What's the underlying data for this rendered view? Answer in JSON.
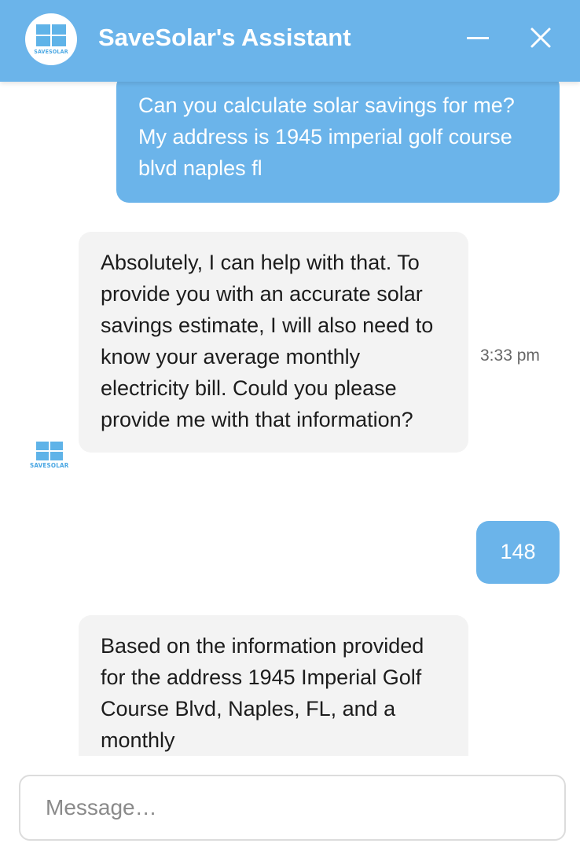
{
  "header": {
    "title": "SaveSolar's Assistant",
    "logo_text": "SAVESOLAR",
    "minimize_icon": "minimize-icon",
    "close_icon": "close-icon",
    "accent_color": "#6bb4ea"
  },
  "messages": [
    {
      "sender": "user",
      "text": "Can you calculate solar savings for me? My address is 1945 imperial golf course blvd naples fl"
    },
    {
      "sender": "bot",
      "text": "Absolutely, I can help with that. To provide you with an accurate solar savings estimate, I will also need to know your average monthly electricity bill. Could you please provide me with that information?",
      "time": "3:33 pm",
      "avatar_text": "SAVESOLAR"
    },
    {
      "sender": "user",
      "text": "148"
    },
    {
      "sender": "bot",
      "text": "Based on the information provided for the address 1945 Imperial Golf Course Blvd, Naples, FL, and a monthly"
    }
  ],
  "composer": {
    "placeholder": "Message…",
    "value": ""
  }
}
